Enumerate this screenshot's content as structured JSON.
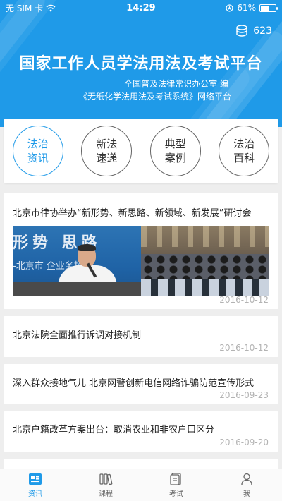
{
  "status": {
    "carrier": "无 SIM 卡",
    "time": "14:29",
    "battery": "61%",
    "battery_level": 0.61
  },
  "header": {
    "points": "623",
    "title": "国家工作人员学法用法及考试平台",
    "subtitle_line1": "全国普及法律常识办公室 编",
    "subtitle_line2": "《无纸化学法用法及考试系统》网络平台"
  },
  "categories": [
    {
      "label": "法治资讯",
      "active": true
    },
    {
      "label": "新法速递",
      "active": false
    },
    {
      "label": "典型案例",
      "active": false
    },
    {
      "label": "法治百科",
      "active": false
    }
  ],
  "news": [
    {
      "title": "北京市律协举办“新形势、新思路、新领域、新发展”研讨会",
      "date": "2016-10-12",
      "photo1_text": "形势 思路",
      "photo1_text2": "-北京市 企业务拓"
    },
    {
      "title": "北京法院全面推行诉调对接机制",
      "date": "2016-10-12"
    },
    {
      "title": "深入群众接地气儿 北京网警创新电信网络诈骗防范宣传形式",
      "date": "2016-09-23"
    },
    {
      "title": "北京户籍改革方案出台：取消农业和非农户口区分",
      "date": "2016-09-20"
    }
  ],
  "tabs": [
    {
      "label": "资讯",
      "icon": "news-icon",
      "active": true
    },
    {
      "label": "课程",
      "icon": "books-icon",
      "active": false
    },
    {
      "label": "考试",
      "icon": "exam-icon",
      "active": false
    },
    {
      "label": "我",
      "icon": "person-icon",
      "active": false
    }
  ],
  "colors": {
    "primary": "#1f9ae8",
    "background": "#eeeeee",
    "date_gray": "#b3b3b3"
  }
}
